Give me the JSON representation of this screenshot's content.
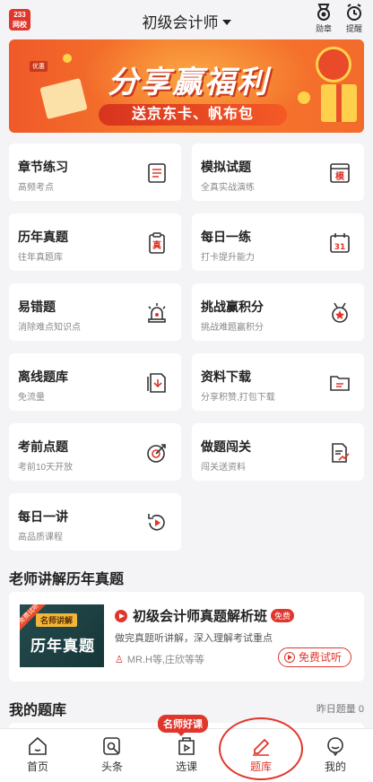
{
  "header": {
    "logo_top": "233",
    "logo_bottom": "网校",
    "title": "初级会计师",
    "medal_label": "勋章",
    "remind_label": "提醒"
  },
  "banner": {
    "ribbon": "优惠",
    "headline": "分享赢福利",
    "subline": "送京东卡、帆布包"
  },
  "grid": [
    {
      "title": "章节练习",
      "sub": "高频考点",
      "icon": "list-icon"
    },
    {
      "title": "模拟试题",
      "sub": "全真实战演练",
      "icon": "mock-exam-icon",
      "glyph": "模"
    },
    {
      "title": "历年真题",
      "sub": "往年真题库",
      "icon": "clipboard-icon",
      "glyph": "真"
    },
    {
      "title": "每日一练",
      "sub": "打卡提升能力",
      "icon": "calendar-icon",
      "glyph": "31"
    },
    {
      "title": "易错题",
      "sub": "消除难点知识点",
      "icon": "alarm-light-icon"
    },
    {
      "title": "挑战赢积分",
      "sub": "挑战难题赢积分",
      "icon": "medal-icon"
    },
    {
      "title": "离线题库",
      "sub": "免流量",
      "icon": "offline-download-icon"
    },
    {
      "title": "资料下载",
      "sub": "分享积赞,打包下载",
      "icon": "folder-icon"
    },
    {
      "title": "考前点题",
      "sub": "考前10天开放",
      "icon": "target-icon"
    },
    {
      "title": "做题闯关",
      "sub": "闯关送资料",
      "icon": "document-chart-icon"
    },
    {
      "title": "每日一讲",
      "sub": "高品质课程",
      "icon": "replay-icon"
    }
  ],
  "section_lectures": {
    "title": "老师讲解历年真题"
  },
  "course": {
    "thumb_tag": "免费试听",
    "thumb_pill": "名师讲解",
    "thumb_title": "历年真题",
    "title": "初级会计师真题解析班",
    "badge": "免费",
    "desc": "做完真题听讲解，深入理解考试重点",
    "teachers": "MR.H等,庄欣等等",
    "trial_button": "免费试听"
  },
  "section_mybank": {
    "title": "我的题库",
    "right": "昨日题量 0"
  },
  "nav": {
    "hot_badge": "名师好课",
    "items": [
      {
        "label": "首页",
        "icon": "home-icon"
      },
      {
        "label": "头条",
        "icon": "news-icon"
      },
      {
        "label": "选课",
        "icon": "course-icon"
      },
      {
        "label": "题库",
        "icon": "pen-icon",
        "active": true
      },
      {
        "label": "我的",
        "icon": "profile-icon"
      }
    ]
  },
  "colors": {
    "accent": "#e0362c",
    "background": "#f4f4f6"
  }
}
